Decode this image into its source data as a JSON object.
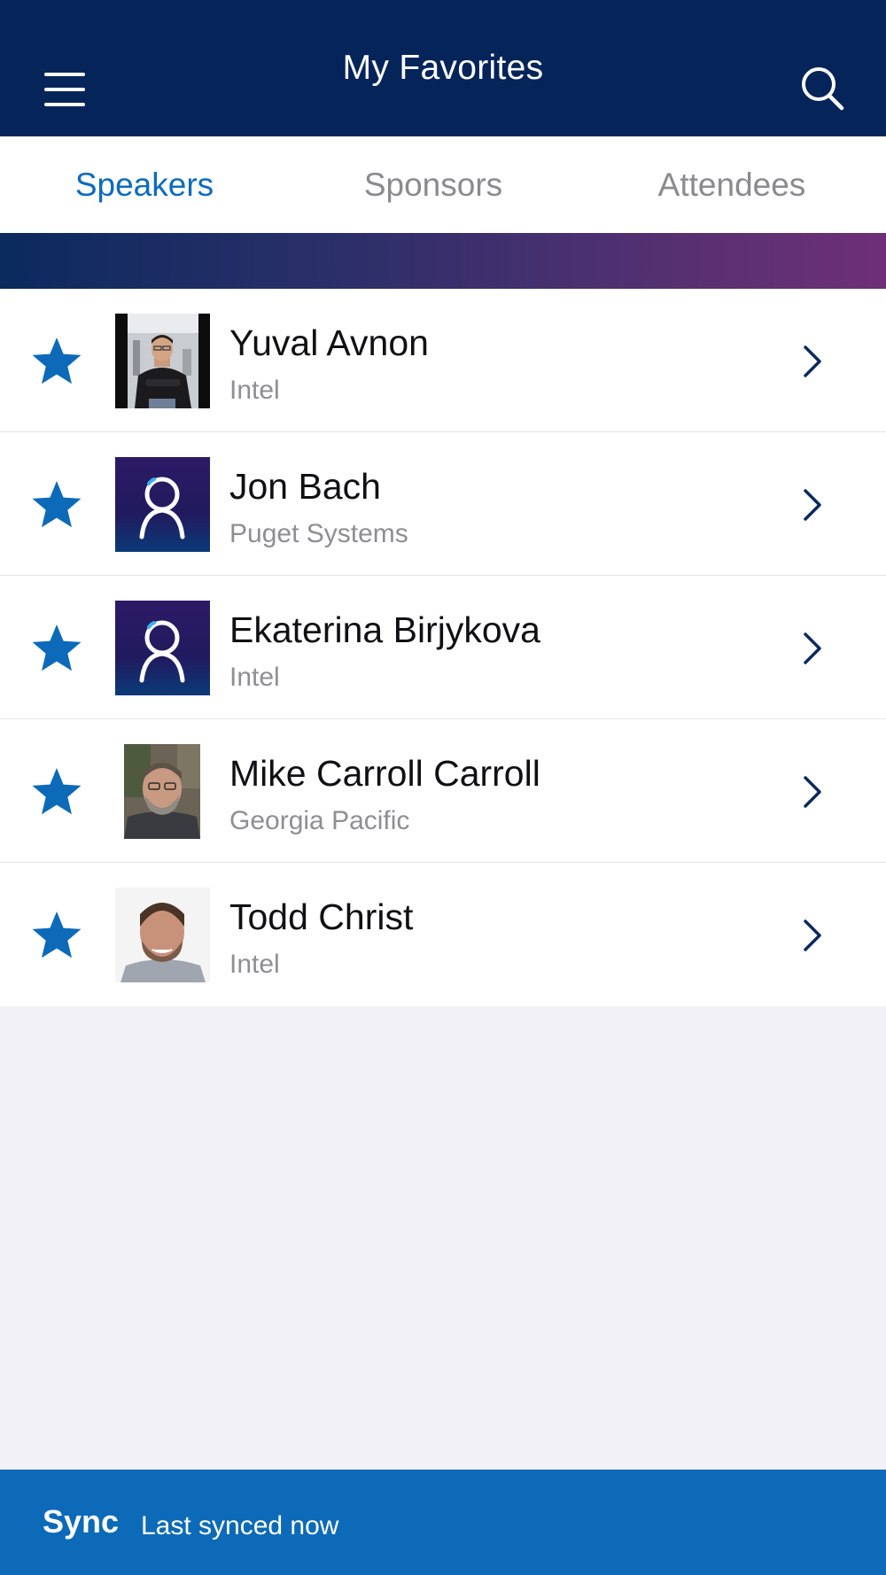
{
  "header": {
    "title": "My Favorites",
    "menu_icon": "hamburger-menu-icon",
    "search_icon": "search-icon",
    "background": "#04245a"
  },
  "tabs": [
    {
      "label": "Speakers",
      "active": true
    },
    {
      "label": "Sponsors",
      "active": false
    },
    {
      "label": "Attendees",
      "active": false
    }
  ],
  "speakers": [
    {
      "name": "Yuval Avnon",
      "company": "Intel",
      "avatar": "photo",
      "favorited": true
    },
    {
      "name": "Jon Bach",
      "company": "Puget Systems",
      "avatar": "placeholder-logo",
      "favorited": true
    },
    {
      "name": "Ekaterina Birjykova",
      "company": "Intel",
      "avatar": "placeholder-logo",
      "favorited": true
    },
    {
      "name": "Mike Carroll Carroll",
      "company": "Georgia Pacific",
      "avatar": "photo",
      "favorited": true
    },
    {
      "name": "Todd Christ",
      "company": "Intel",
      "avatar": "photo",
      "favorited": true
    }
  ],
  "sync": {
    "label": "Sync",
    "status": "Last synced now"
  },
  "colors": {
    "accent": "#0d6bbd",
    "star": "#0c6ab8",
    "chevron": "#0b2a5e",
    "sync_bar": "#0c6ab8"
  }
}
